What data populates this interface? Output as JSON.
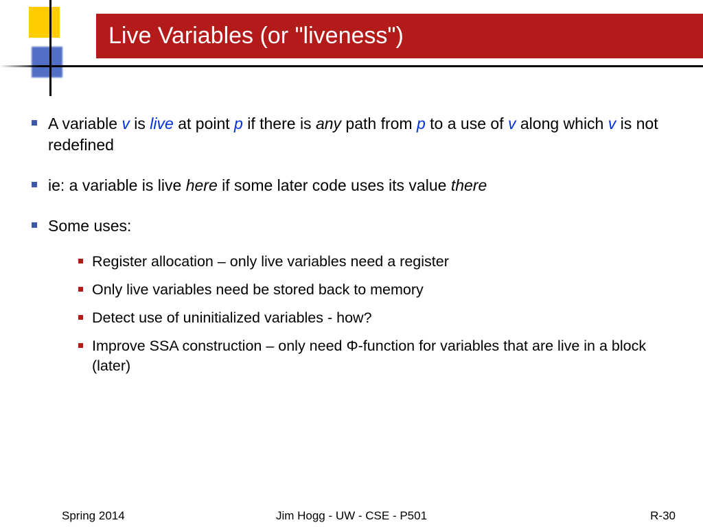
{
  "title": "Live Variables (or \"liveness\")",
  "bullet1": {
    "t1": "A variable ",
    "v1": "v",
    "t2": "  is ",
    "live": "live",
    "t3": " at point ",
    "p1": "p",
    "t4": "  if there is ",
    "any": "any",
    "t5": " path from ",
    "p2": "p",
    "t6": "  to a use of ",
    "v2": "v",
    "t7": " along which ",
    "v3": "v",
    "t8": "  is not redefined"
  },
  "bullet2": {
    "t1": "ie: a variable is live ",
    "here": "here",
    "t2": " if some later code uses its value ",
    "there": "there"
  },
  "bullet3": "Some uses:",
  "sub": {
    "a": "Register allocation – only live variables need a register",
    "b": "Only live variables need be stored back to memory",
    "c": "Detect use of uninitialized variables - how?",
    "d": "Improve SSA construction – only need Φ-function for variables that are live in a block (later)"
  },
  "footer": {
    "left": "Spring 2014",
    "center": "Jim Hogg - UW - CSE - P501",
    "right": "R-30"
  }
}
